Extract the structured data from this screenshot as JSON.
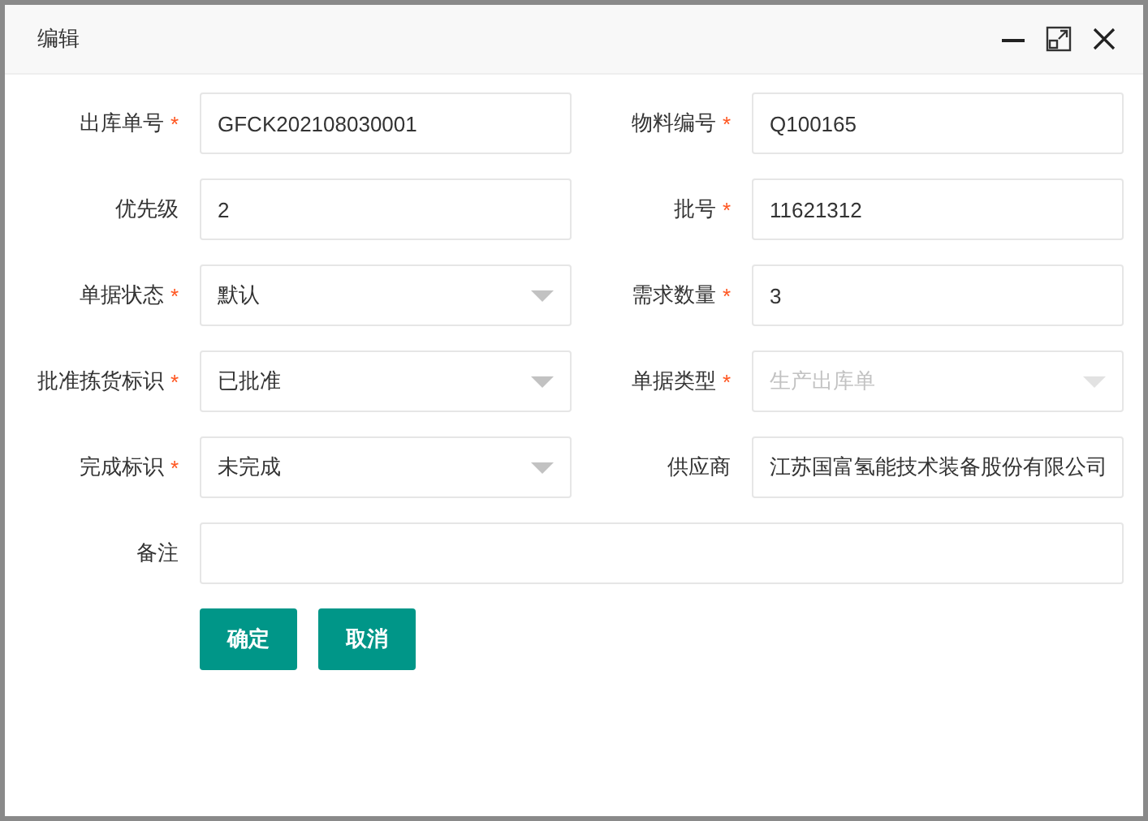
{
  "dialog": {
    "title": "编辑"
  },
  "fields": [
    {
      "label": "出库单号",
      "required_mark": "*",
      "kind": "text",
      "value": "GFCK202108030001",
      "disabled": false
    },
    {
      "label": "物料编号",
      "required_mark": "*",
      "kind": "text",
      "value": "Q100165",
      "disabled": false
    },
    {
      "label": "优先级",
      "kind": "text",
      "value": "2",
      "disabled": false
    },
    {
      "label": "批号",
      "required_mark": "*",
      "kind": "text",
      "value": "11621312",
      "disabled": false
    },
    {
      "label": "单据状态",
      "required_mark": "*",
      "kind": "select",
      "value": "默认",
      "disabled": false
    },
    {
      "label": "需求数量",
      "required_mark": "*",
      "kind": "text",
      "value": "3",
      "disabled": false
    },
    {
      "label": "批准拣货标识",
      "required_mark": "*",
      "kind": "select",
      "value": "已批准",
      "disabled": false
    },
    {
      "label": "单据类型",
      "required_mark": "*",
      "kind": "select",
      "value": "生产出库单",
      "disabled": true
    },
    {
      "label": "完成标识",
      "required_mark": "*",
      "kind": "select",
      "value": "未完成",
      "disabled": false
    },
    {
      "label": "供应商",
      "kind": "text",
      "value": "江苏国富氢能技术装备股份有限公司",
      "disabled": false
    }
  ],
  "note": {
    "label": "备注"
  },
  "buttons": [
    "确定",
    "取消"
  ]
}
